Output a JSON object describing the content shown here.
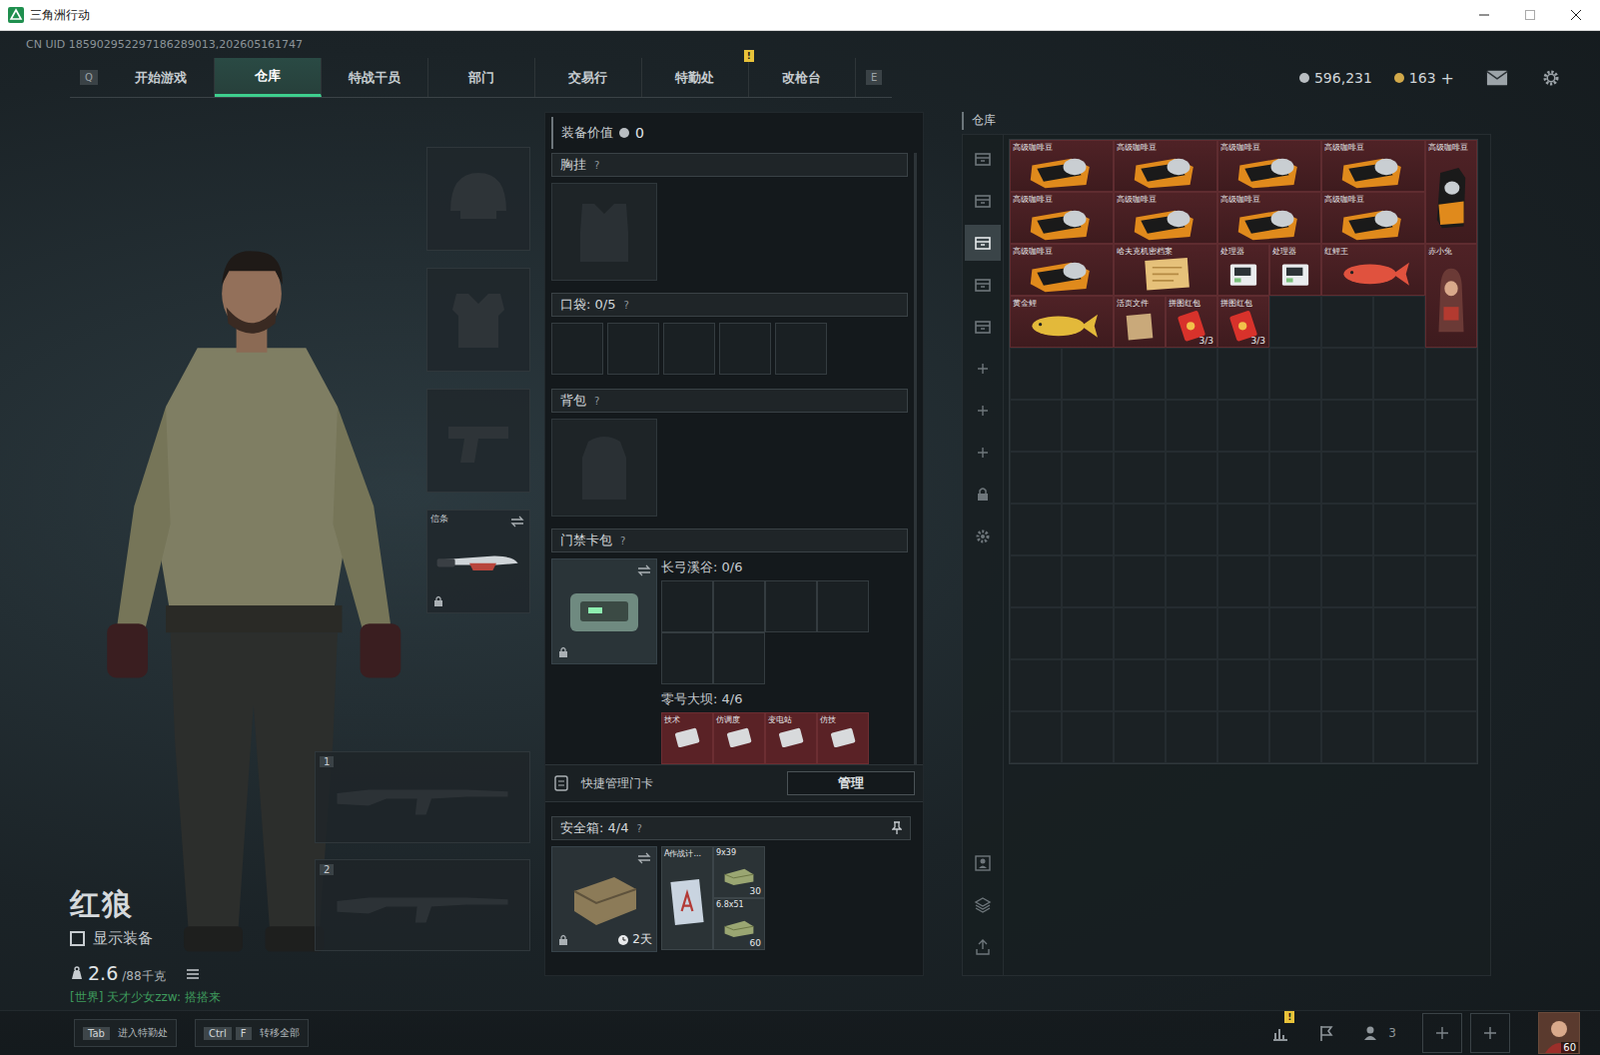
{
  "window": {
    "title": "三角洲行动"
  },
  "uid": "CN UID 185902952297186289013,202605161747",
  "notice_mark": "!",
  "nav": {
    "prev_key": "Q",
    "next_key": "E",
    "tabs": [
      {
        "label": "开始游戏",
        "selected": false,
        "notice": false
      },
      {
        "label": "仓库",
        "selected": true,
        "notice": false
      },
      {
        "label": "特战干员",
        "selected": false,
        "notice": false
      },
      {
        "label": "部门",
        "selected": false,
        "notice": false
      },
      {
        "label": "交易行",
        "selected": false,
        "notice": false
      },
      {
        "label": "特勤处",
        "selected": false,
        "notice": true
      },
      {
        "label": "改枪台",
        "selected": false,
        "notice": false
      }
    ]
  },
  "wallet": [
    {
      "amount": "596,231",
      "color": "#b9bec2"
    },
    {
      "amount": "163",
      "color": "#d2a94a",
      "add": "+"
    }
  ],
  "character": {
    "name": "红狼",
    "show_gear": {
      "label": "显示装备",
      "checked": false
    },
    "weight": "2.6",
    "weight_limit": "/88千克",
    "chat": "[世界] 天才少女zzw: 搭搭来"
  },
  "gear_slots": [
    {
      "kind": "helmet",
      "label": "",
      "locked": false
    },
    {
      "kind": "armor",
      "label": "",
      "locked": false
    },
    {
      "kind": "pistol",
      "label": "",
      "locked": false
    },
    {
      "kind": "melee",
      "label": "信条",
      "locked": true
    }
  ],
  "weapon_slots": [
    {
      "number": "1"
    },
    {
      "number": "2"
    }
  ],
  "loadout": {
    "value_label": "装备价值",
    "value": "0",
    "chest": {
      "label": "胸挂",
      "help": "?"
    },
    "pockets": {
      "label": "口袋: 0/5",
      "help": "?",
      "slots": [
        {
          "filled": false
        },
        {
          "filled": false
        },
        {
          "filled": false
        },
        {
          "filled": false
        },
        {
          "filled": false
        }
      ]
    },
    "backpack": {
      "label": "背包",
      "help": "?"
    },
    "card_pack": {
      "label": "门禁卡包",
      "help": "?",
      "locked": true,
      "maps": [
        {
          "name": "长弓溪谷: 0/6",
          "cards": [
            {
              "label": "",
              "filled": false
            },
            {
              "label": "",
              "filled": false
            },
            {
              "label": "",
              "filled": false
            },
            {
              "label": "",
              "filled": false
            },
            {
              "label": "",
              "filled": false
            },
            {
              "label": "",
              "filled": false
            }
          ]
        },
        {
          "name": "零号大坝: 4/6",
          "cards": [
            {
              "label": "技术",
              "filled": true
            },
            {
              "label": "仿调度",
              "filled": true
            },
            {
              "label": "变电站",
              "filled": true
            },
            {
              "label": "仿技",
              "filled": true
            }
          ]
        }
      ]
    },
    "quick_manage": {
      "label": "快捷管理门卡",
      "button": "管理"
    },
    "safe": {
      "label": "安全箱: 4/4",
      "help": "?",
      "timer": "2天",
      "locked": true,
      "pinned": true,
      "items": [
        {
          "name": "A作战计...",
          "kind": "document",
          "count": ""
        },
        {
          "name": "9x39",
          "kind": "ammo",
          "count": "30"
        },
        {
          "name": "6.8x51",
          "kind": "ammo",
          "count": "60"
        }
      ]
    }
  },
  "warehouse": {
    "title": "仓库",
    "tabs": [
      {
        "selected": false
      },
      {
        "selected": false
      },
      {
        "selected": true
      },
      {
        "selected": false
      },
      {
        "selected": false
      }
    ],
    "items": [
      {
        "name": "高级咖啡豆",
        "kind": "coffee",
        "count": ""
      },
      {
        "name": "高级咖啡豆",
        "kind": "coffee",
        "count": ""
      },
      {
        "name": "高级咖啡豆",
        "kind": "coffee",
        "count": ""
      },
      {
        "name": "高级咖啡豆",
        "kind": "coffee",
        "count": ""
      },
      {
        "name": "高级咖啡豆",
        "kind": "coffee-tall",
        "count": ""
      },
      {
        "name": "高级咖啡豆",
        "kind": "coffee",
        "count": ""
      },
      {
        "name": "高级咖啡豆",
        "kind": "coffee",
        "count": ""
      },
      {
        "name": "高级咖啡豆",
        "kind": "coffee",
        "count": ""
      },
      {
        "name": "高级咖啡豆",
        "kind": "coffee",
        "count": ""
      },
      {
        "name": "高级咖啡豆",
        "kind": "coffee",
        "count": ""
      },
      {
        "name": "哈夫克机密档案",
        "kind": "document",
        "count": ""
      },
      {
        "name": "处理器",
        "kind": "chip",
        "count": ""
      },
      {
        "name": "处理器",
        "kind": "chip",
        "count": ""
      },
      {
        "name": "红鲤王",
        "kind": "fish",
        "count": "",
        "color": "#e0523e"
      },
      {
        "name": "赤小兔",
        "kind": "figure",
        "count": ""
      },
      {
        "name": "黄金鲤",
        "kind": "fish",
        "count": "",
        "color": "#e3b93a"
      },
      {
        "name": "活页文件",
        "kind": "folder",
        "count": ""
      },
      {
        "name": "拼图红包",
        "kind": "packet",
        "count": "3/3"
      },
      {
        "name": "拼图红包",
        "kind": "packet",
        "count": "3/3"
      }
    ]
  },
  "bottom": {
    "hints": [
      {
        "keys": [
          "Tab"
        ],
        "label": "进入特勤处"
      },
      {
        "keys": [
          "Ctrl",
          "F"
        ],
        "label": "转移全部"
      }
    ],
    "stats_notice": true,
    "friends": "3",
    "level": "60"
  }
}
